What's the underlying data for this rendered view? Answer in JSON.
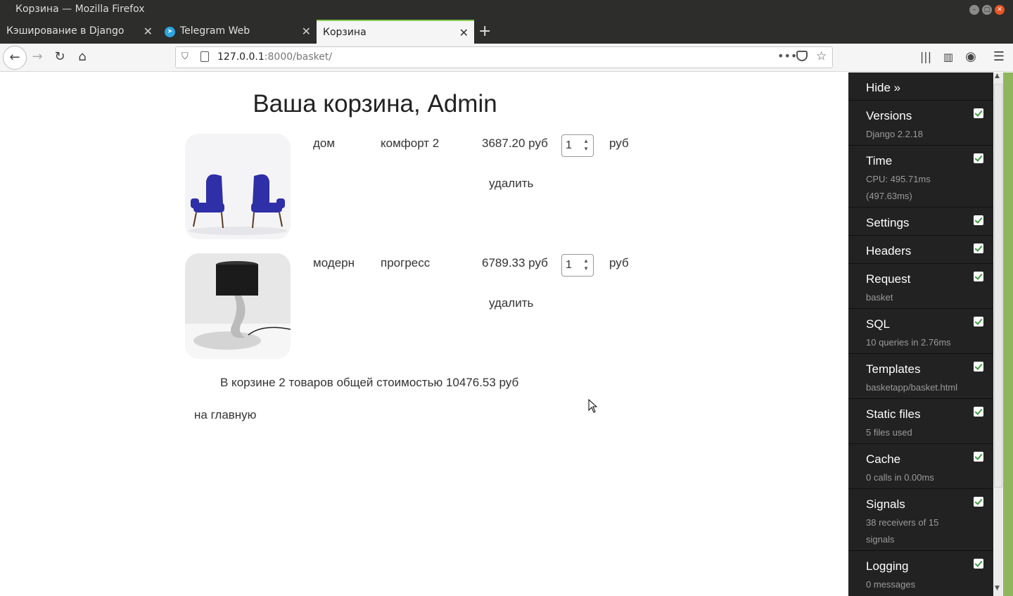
{
  "window": {
    "title": "Корзина — Mozilla Firefox"
  },
  "tabs": [
    {
      "label": "Кэширование в Django"
    },
    {
      "label": "Telegram Web"
    },
    {
      "label": "Корзина"
    }
  ],
  "url": {
    "host": "127.0.0.1",
    "path": ":8000/basket/"
  },
  "page": {
    "title": "Ваша корзина, Admin",
    "items": [
      {
        "category": "дом",
        "name": "комфорт 2",
        "price": "3687.20 руб",
        "quantity": "1",
        "currency": "руб",
        "delete": "удалить"
      },
      {
        "category": "модерн",
        "name": "прогресс",
        "price": "6789.33 руб",
        "quantity": "1",
        "currency": "руб",
        "delete": "удалить"
      }
    ],
    "summary": "В корзине 2 товаров общей стоимостью 10476.53 руб",
    "home_link": "на главную"
  },
  "debug_toolbar": {
    "hide": "Hide »",
    "panels": [
      {
        "title": "Versions",
        "sub": "Django 2.2.18"
      },
      {
        "title": "Time",
        "sub": "CPU: 495.71ms (497.63ms)"
      },
      {
        "title": "Settings",
        "sub": ""
      },
      {
        "title": "Headers",
        "sub": ""
      },
      {
        "title": "Request",
        "sub": "basket"
      },
      {
        "title": "SQL",
        "sub": "10 queries in 2.76ms"
      },
      {
        "title": "Templates",
        "sub": "basketapp/basket.html"
      },
      {
        "title": "Static files",
        "sub": "5 files used"
      },
      {
        "title": "Cache",
        "sub": "0 calls in 0.00ms"
      },
      {
        "title": "Signals",
        "sub": "38 receivers of 15 signals"
      },
      {
        "title": "Logging",
        "sub": "0 messages"
      }
    ]
  },
  "colors": {
    "accent": "#8fd05a",
    "toolbar_bg": "#222222",
    "check": "#3c9a3c"
  }
}
